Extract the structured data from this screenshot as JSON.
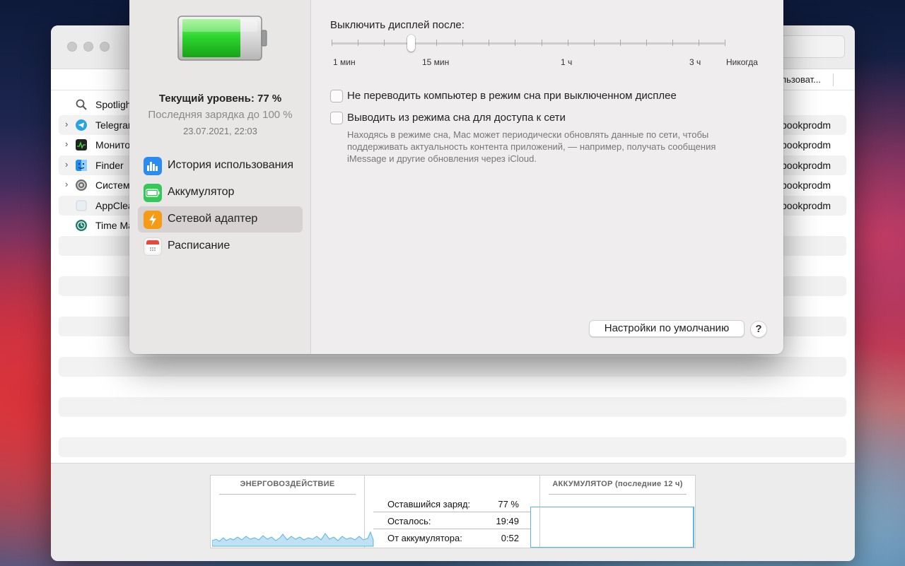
{
  "activity_monitor": {
    "user_column_header": "Пользоват...",
    "processes": [
      {
        "name": "Spotlight",
        "user": "",
        "expandable": false,
        "icon": "spotlight-icon"
      },
      {
        "name": "Telegram",
        "user": "bookprodm",
        "expandable": true,
        "icon": "telegram-icon"
      },
      {
        "name": "Монитор",
        "user": "bookprodm",
        "expandable": true,
        "icon": "activity-monitor-icon"
      },
      {
        "name": "Finder",
        "user": "bookprodm",
        "expandable": true,
        "icon": "finder-icon"
      },
      {
        "name": "Систем",
        "user": "bookprodm",
        "expandable": true,
        "icon": "system-preferences-icon"
      },
      {
        "name": "AppClea",
        "user": "bookprodm",
        "expandable": false,
        "icon": "appcleaner-icon"
      },
      {
        "name": "Time Ma",
        "user": "",
        "expandable": false,
        "icon": "time-machine-icon"
      }
    ],
    "energy_panel": {
      "energy_impact_title": "ЭНЕРГОВОЗДЕЙСТВИЕ",
      "battery_title": "АККУМУЛЯТОР (последние 12 ч)",
      "stats": [
        {
          "label": "Оставшийся заряд:",
          "value": "77 %"
        },
        {
          "label": "Осталось:",
          "value": "19:49"
        },
        {
          "label": "От аккумулятора:",
          "value": "0:52"
        }
      ]
    }
  },
  "battery_prefs": {
    "level_text": "Текущий уровень: 77 %",
    "last_charge_text": "Последняя зарядка до 100 %",
    "last_charge_date": "23.07.2021, 22:03",
    "battery_fill_level": 0.77,
    "sidebar_items": [
      {
        "label": "История использования",
        "icon": "usage-history-icon",
        "selected": false
      },
      {
        "label": "Аккумулятор",
        "icon": "battery-icon",
        "selected": false
      },
      {
        "label": "Сетевой адаптер",
        "icon": "power-adapter-icon",
        "selected": true
      },
      {
        "label": "Расписание",
        "icon": "schedule-icon",
        "selected": false
      }
    ],
    "display_sleep": {
      "title": "Выключить дисплей после:",
      "tick_labels": [
        "1 мин",
        "15 мин",
        "1 ч",
        "3 ч",
        "Никогда"
      ],
      "selected_value": "15 мин"
    },
    "options": [
      {
        "label": "Не переводить компьютер в режим сна при выключенном дисплее",
        "checked": false
      },
      {
        "label": "Выводить из режима сна для доступа к сети",
        "checked": false
      }
    ],
    "network_wake_description": "Находясь в режиме сна, Mac может периодически обновлять данные по сети, чтобы поддерживать актуальность контента приложений, — например, получать сообщения iMessage и другие обновления через iCloud.",
    "defaults_button": "Настройки по умолчанию",
    "help_button": "?"
  },
  "colors": {
    "battery_green": "#2fd62f",
    "selected_item": "#d6d2d2",
    "energy_line": "#5ab5e0"
  }
}
